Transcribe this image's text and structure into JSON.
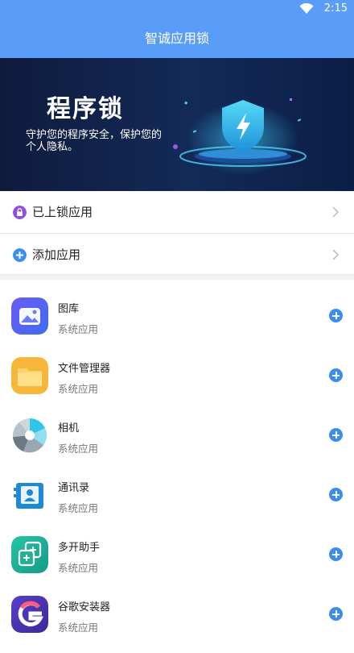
{
  "status": {
    "time": "2:15"
  },
  "header": {
    "title": "智诚应用锁"
  },
  "banner": {
    "title": "程序锁",
    "subtitle": "守护您的程序安全，保护您的个人隐私。"
  },
  "menu": [
    {
      "label": "已上锁应用",
      "icon": "lock-icon"
    },
    {
      "label": "添加应用",
      "icon": "plus-icon"
    }
  ],
  "apps": [
    {
      "name": "图库",
      "type": "系统应用",
      "icon": "gallery-icon"
    },
    {
      "name": "文件管理器",
      "type": "系统应用",
      "icon": "folder-icon"
    },
    {
      "name": "相机",
      "type": "系统应用",
      "icon": "camera-icon"
    },
    {
      "name": "通讯录",
      "type": "系统应用",
      "icon": "contacts-icon"
    },
    {
      "name": "多开助手",
      "type": "系统应用",
      "icon": "multi-open-icon"
    },
    {
      "name": "谷歌安装器",
      "type": "系统应用",
      "icon": "google-installer-icon"
    }
  ],
  "colors": {
    "primary": "#5a9df8",
    "accent": "#3b8ef0",
    "lock": "#8f4fe0"
  }
}
